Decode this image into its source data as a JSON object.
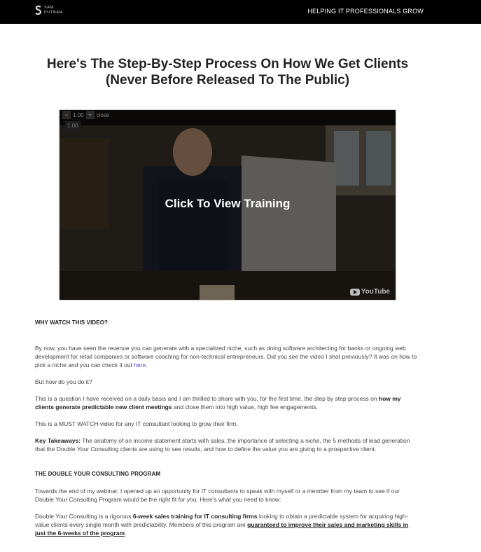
{
  "header": {
    "logo_line1": "SAM",
    "logo_line2": "PUTNAM",
    "tagline": "HELPING IT PROFESSIONALS GROW"
  },
  "headline": "Here's The Step-By-Step Process On How We Get Clients (Never Before Released To The Public)",
  "video": {
    "cta": "Click To View Training",
    "controls": {
      "minus": "−",
      "speed": "1.00",
      "plus": "+",
      "close": "close",
      "time": "1.00"
    },
    "provider": "YouTube"
  },
  "why": {
    "title": "WHY WATCH THIS VIDEO?",
    "p1_a": "By now, you have seen the revenue you can generate with a specialized niche, such as doing software architecting for banks or ongoing web development for retail companies or software coaching for non-technical entrepreneurs. Did you see the video I shot previously? It was on how to pick a niche and you can check it out ",
    "p1_link": "here",
    "p1_end": ".",
    "p2": "But how do you do it?",
    "p3_a": "This is a question I have received on a daily basis and I am thrilled to share with you, for the first time, the step by step process on ",
    "p3_bold": "how my clients generate predictable new client meetings",
    "p3_b": " and close them into high value, high fee engagements.",
    "p4": "This is a MUST WATCH video for any IT consultant looking to grow their firm.",
    "p5_bold": "Key Takeaways:",
    "p5": " The anatomy of an income statement starts with sales, the importance of selecting a niche, the 5 methods of lead generation that the Double Your Consulting clients are using to see results, and how to define the value you are giving to a prospective client."
  },
  "program": {
    "title": "THE DOUBLE YOUR CONSULTING PROGRAM",
    "p1": "Towards the end of my webinar, I opened up an opportunity for IT consultants to speak with myself or a member from my team to see if our Double Your Consulting Program would be the right fit for you. Here's what you need to know:",
    "p2_a": "Double Your Consulting is a rigorous ",
    "p2_bold": "6-week sales training for IT consulting firms",
    "p2_b": " looking to obtain a predictable system for acquiring high-value clients every single month with predictability. Members of this program are ",
    "p2_ul": "guaranteed to improve their sales and marketing skills in just the 6-weeks of the program",
    "p2_end": "."
  }
}
